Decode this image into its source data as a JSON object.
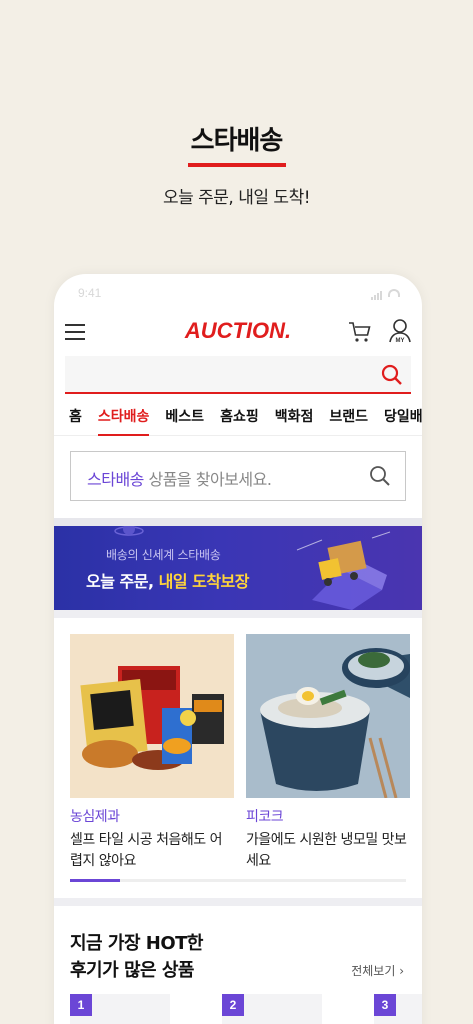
{
  "promo": {
    "title": "스타배송",
    "subtitle": "오늘 주문, 내일 도착!"
  },
  "status_bar": {
    "time": "9:41"
  },
  "header": {
    "logo": "AUCTION."
  },
  "nav_tabs": [
    "홈",
    "스타배송",
    "베스트",
    "홈쇼핑",
    "백화점",
    "브랜드",
    "당일배"
  ],
  "active_tab": "스타배송",
  "star_search": {
    "brand": "스타배송",
    "placeholder": "상품을 찾아보세요."
  },
  "banner": {
    "line1": "배송의 신세계 스타배송",
    "line2_a": "오늘 주문, ",
    "line2_b": "내일 도착보장"
  },
  "cards": [
    {
      "brand": "농심제과",
      "desc": "셀프 타일 시공 처음해도 어렵지 않아요"
    },
    {
      "brand": "피코크",
      "desc": "가을에도 시원한 냉모밀 맛보세요"
    }
  ],
  "carousel_progress": 0.15,
  "hot_section": {
    "title_line1": "지금 가장 HOT한",
    "title_line2": "후기가 많은 상품",
    "view_all": "전체보기 ›",
    "ranks": [
      "1",
      "2",
      "3"
    ]
  },
  "colors": {
    "accent": "#e01d1d",
    "purple": "#6b46d6",
    "background": "#f3efe6"
  }
}
